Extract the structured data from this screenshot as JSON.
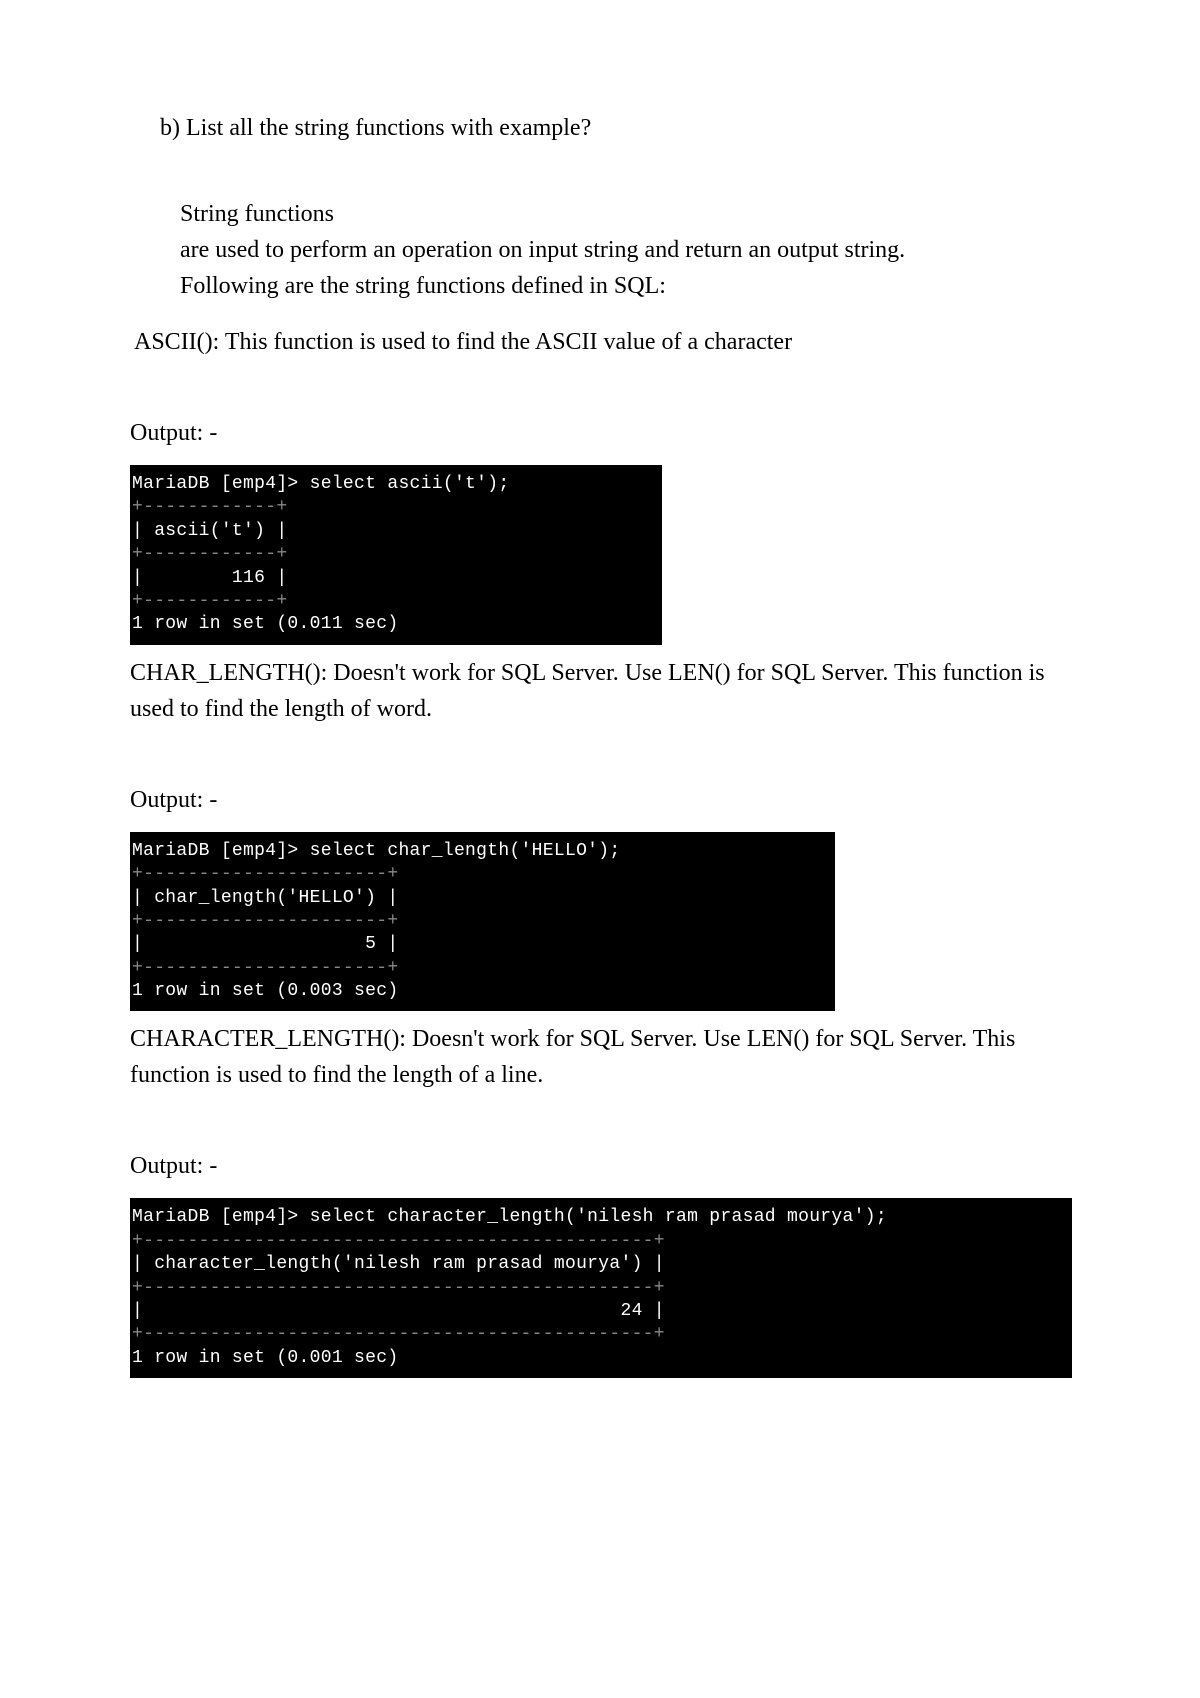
{
  "question": "b) List all the string functions with example?",
  "intro": {
    "heading": "String functions",
    "line1": "are used to perform an operation on input string and return an output string.",
    "line2": "Following are the string functions defined in SQL:"
  },
  "sections": [
    {
      "desc": "ASCII(): This function is used to find the ASCII value of a character",
      "output_label": "Output: -",
      "terminal": {
        "prompt": "MariaDB [emp4]> select ascii('t');",
        "sep1": "+------------+",
        "header": "| ascii('t') |",
        "sep2": "+------------+",
        "value": "|        116 |",
        "sep3": "+------------+",
        "footer": "1 row in set (0.011 sec)"
      }
    },
    {
      "desc": "CHAR_LENGTH(): Doesn't work for SQL Server. Use LEN() for SQL Server. This function is used to find the length of word.",
      "output_label": "Output: -",
      "terminal": {
        "prompt": "MariaDB [emp4]> select char_length('HELLO');",
        "sep1": "+----------------------+",
        "header": "| char_length('HELLO') |",
        "sep2": "+----------------------+",
        "value": "|                    5 |",
        "sep3": "+----------------------+",
        "footer": "1 row in set (0.003 sec)"
      }
    },
    {
      "desc": "CHARACTER_LENGTH(): Doesn't work for SQL Server. Use LEN() for SQL Server. This function is used to find the length of a line.",
      "output_label": "Output: -",
      "terminal": {
        "prompt": "MariaDB [emp4]> select character_length('nilesh ram prasad mourya');",
        "sep1": "+----------------------------------------------+",
        "header": "| character_length('nilesh ram prasad mourya') |",
        "sep2": "+----------------------------------------------+",
        "value": "|                                           24 |",
        "sep3": "+----------------------------------------------+",
        "footer": "1 row in set (0.001 sec)"
      }
    }
  ]
}
